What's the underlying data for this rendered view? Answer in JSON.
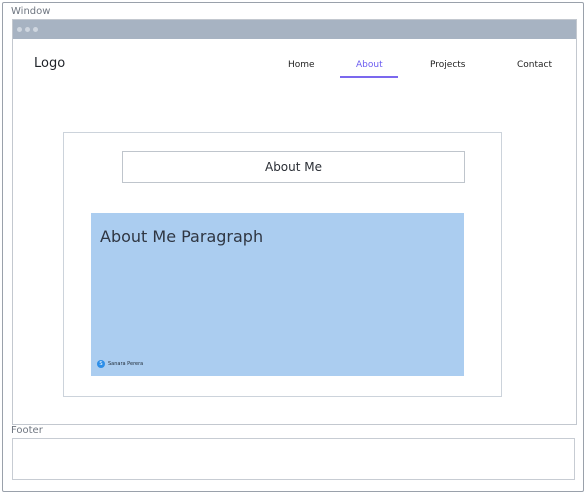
{
  "labels": {
    "window": "Window",
    "footer": "Footer"
  },
  "header": {
    "logo": "Logo"
  },
  "nav": {
    "home": "Home",
    "about": "About",
    "projects": "Projects",
    "contact": "Contact",
    "active": "About",
    "accent_color": "#7b68ee"
  },
  "main": {
    "heading": "About Me",
    "paragraph_title": "About Me Paragraph",
    "paragraph_bg": "#abcdf0",
    "author": {
      "initial": "S",
      "name": "Sanara Perera"
    }
  }
}
